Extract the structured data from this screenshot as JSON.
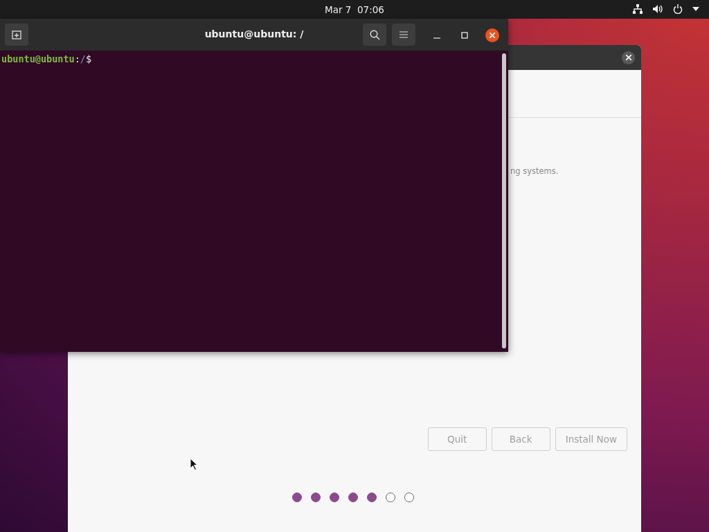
{
  "top_bar": {
    "clock": "Mar 7  07:06"
  },
  "installer": {
    "visible_text": "ng systems.",
    "buttons": [
      {
        "label": "Quit",
        "disabled": true
      },
      {
        "label": "Back",
        "disabled": true
      },
      {
        "label": "Install Now",
        "disabled": true
      }
    ],
    "steps": [
      {
        "done": true
      },
      {
        "done": true
      },
      {
        "done": true
      },
      {
        "done": true
      },
      {
        "done": true
      },
      {
        "done": false
      },
      {
        "done": false
      }
    ]
  },
  "terminal": {
    "title": "ubuntu@ubuntu: /",
    "prompt_user": "ubuntu@ubuntu",
    "prompt_sep": ":",
    "prompt_path": "/",
    "prompt_symbol": "$"
  }
}
